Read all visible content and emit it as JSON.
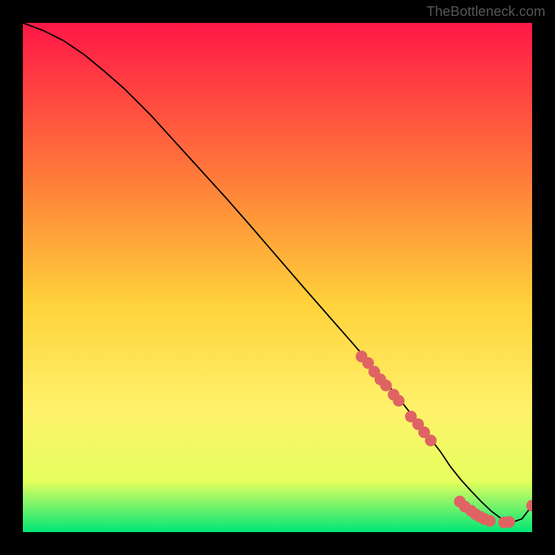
{
  "watermark": "TheBottleneck.com",
  "gradient": {
    "top": "#ff1747",
    "mid1": "#ff7a3a",
    "mid2": "#ffd23a",
    "mid3": "#fff26b",
    "mid4": "#e5ff5e",
    "bottom": "#00e676"
  },
  "chart_data": {
    "type": "line",
    "title": "",
    "xlabel": "",
    "ylabel": "",
    "xlim": [
      0,
      100
    ],
    "ylim": [
      0,
      100
    ],
    "series": [
      {
        "name": "bottleneck-curve",
        "x": [
          0,
          4,
          8,
          12,
          16,
          20,
          25,
          30,
          35,
          40,
          45,
          50,
          55,
          60,
          65,
          70,
          73,
          76,
          79,
          82,
          84,
          86,
          88,
          90,
          92,
          94,
          96,
          98,
          100
        ],
        "y": [
          100,
          98.5,
          96.5,
          93.8,
          90.5,
          87,
          82,
          76.5,
          71,
          65.5,
          59.8,
          54,
          48.2,
          42.5,
          36.8,
          31,
          27.3,
          23.5,
          19.7,
          15.8,
          12.8,
          10.3,
          8.1,
          6,
          4.1,
          2.6,
          1.9,
          2.6,
          5.2
        ]
      }
    ],
    "marker_clusters": [
      {
        "name": "upper-cluster",
        "points": [
          {
            "x": 66.5,
            "y": 34.5
          },
          {
            "x": 67.8,
            "y": 33.2
          },
          {
            "x": 69.0,
            "y": 31.5
          },
          {
            "x": 70.2,
            "y": 30.0
          },
          {
            "x": 71.3,
            "y": 28.8
          },
          {
            "x": 72.8,
            "y": 27.0
          },
          {
            "x": 73.8,
            "y": 25.8
          }
        ]
      },
      {
        "name": "mid-cluster",
        "points": [
          {
            "x": 76.2,
            "y": 22.7
          },
          {
            "x": 77.6,
            "y": 21.2
          },
          {
            "x": 78.8,
            "y": 19.6
          },
          {
            "x": 80.1,
            "y": 18.0
          }
        ]
      },
      {
        "name": "bottom-cluster",
        "points": [
          {
            "x": 85.8,
            "y": 6.0
          },
          {
            "x": 86.8,
            "y": 5.0
          },
          {
            "x": 88.0,
            "y": 4.2
          },
          {
            "x": 88.9,
            "y": 3.5
          },
          {
            "x": 89.8,
            "y": 3.0
          },
          {
            "x": 90.6,
            "y": 2.6
          },
          {
            "x": 91.7,
            "y": 2.2
          },
          {
            "x": 94.5,
            "y": 1.9
          },
          {
            "x": 95.5,
            "y": 2.0
          }
        ]
      },
      {
        "name": "end-point",
        "points": [
          {
            "x": 100,
            "y": 5.2
          }
        ]
      }
    ]
  }
}
